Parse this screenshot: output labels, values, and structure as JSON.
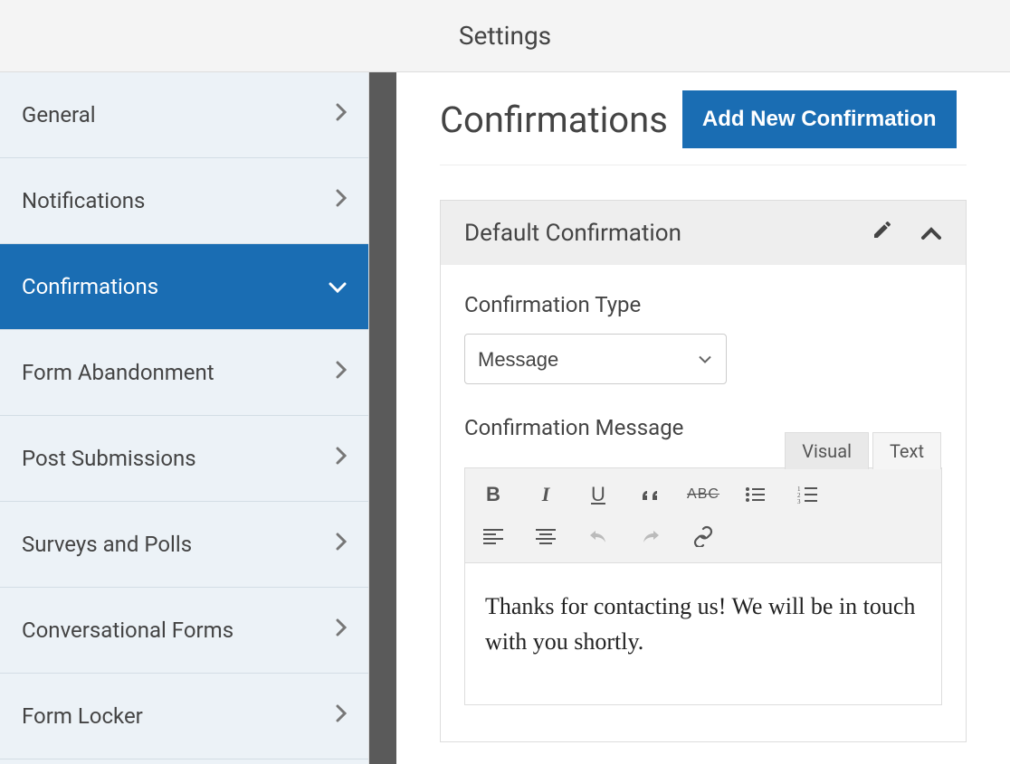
{
  "header": {
    "title": "Settings"
  },
  "sidebar": {
    "items": [
      {
        "label": "General",
        "active": false
      },
      {
        "label": "Notifications",
        "active": false
      },
      {
        "label": "Confirmations",
        "active": true
      },
      {
        "label": "Form Abandonment",
        "active": false
      },
      {
        "label": "Post Submissions",
        "active": false
      },
      {
        "label": "Surveys and Polls",
        "active": false
      },
      {
        "label": "Conversational Forms",
        "active": false
      },
      {
        "label": "Form Locker",
        "active": false
      }
    ]
  },
  "main": {
    "page_title": "Confirmations",
    "add_button": "Add New Confirmation",
    "panel": {
      "title": "Default Confirmation",
      "type_label": "Confirmation Type",
      "type_value": "Message",
      "message_label": "Confirmation Message",
      "tabs": {
        "visual": "Visual",
        "text": "Text"
      },
      "toolbar": {
        "bold": "B",
        "italic": "I",
        "underline": "U",
        "quote": "❝",
        "strike": "ABC",
        "ul": "list-ul",
        "ol": "list-ol",
        "align_left": "align-left",
        "align_center": "align-center",
        "undo": "undo",
        "redo": "redo",
        "link": "link"
      },
      "content": "Thanks for contacting us! We will be in touch with you shortly."
    }
  },
  "colors": {
    "accent": "#1a6db3",
    "sidebar_bg": "#ecf2f7",
    "annotation": "#ff0000"
  }
}
